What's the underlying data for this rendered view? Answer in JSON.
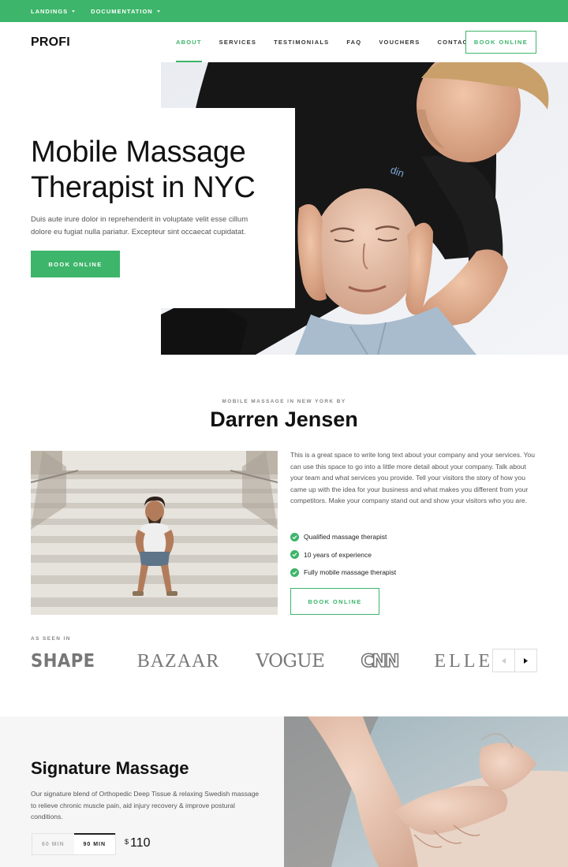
{
  "topbar": {
    "items": [
      {
        "label": "LANDINGS"
      },
      {
        "label": "DOCUMENTATION"
      }
    ]
  },
  "header": {
    "logo": "PROFI",
    "nav": [
      "ABOUT",
      "SERVICES",
      "TESTIMONIALS",
      "FAQ",
      "VOUCHERS",
      "CONTACT"
    ],
    "active_nav": "ABOUT",
    "cta": "BOOK ONLINE"
  },
  "hero": {
    "title": "Mobile Massage Therapist in NYC",
    "text": "Duis aute irure dolor in reprehenderit in voluptate velit esse cillum dolore eu fugiat nulla pariatur. Excepteur sint occaecat cupidatat.",
    "button": "BOOK ONLINE",
    "shirt_text": "din"
  },
  "about": {
    "eyebrow": "MOBILE MASSAGE IN NEW YORK BY",
    "title": "Darren Jensen",
    "text": "This is a great space to write long text about your company and your services. You can use this space to go into a little more detail about your company. Talk about your team and what services you provide. Tell your visitors the story of how you came up with the idea for your business and what makes you different from your competitors. Make your company stand out and show your visitors who you are.",
    "checks": [
      "Qualified massage therapist",
      "10 years of experience",
      "Fully mobile massage therapist"
    ],
    "button": "BOOK ONLINE"
  },
  "press": {
    "label": "AS SEEN IN",
    "logos": [
      "SHAPE",
      "BAZAAR",
      "VOGUE",
      "CNN",
      "ELLE"
    ]
  },
  "signature": {
    "title": "Signature Massage",
    "text": "Our signature blend of Orthopedic Deep Tissue & relaxing Swedish massage to relieve chronic muscle pain, aid injury recovery & improve postural conditions.",
    "tabs": [
      "60 MIN",
      "90 MIN"
    ],
    "selected_tab": "90 MIN",
    "currency": "$",
    "price": "110"
  },
  "colors": {
    "accent": "#3db56a",
    "text": "#111111",
    "muted": "#555555"
  }
}
